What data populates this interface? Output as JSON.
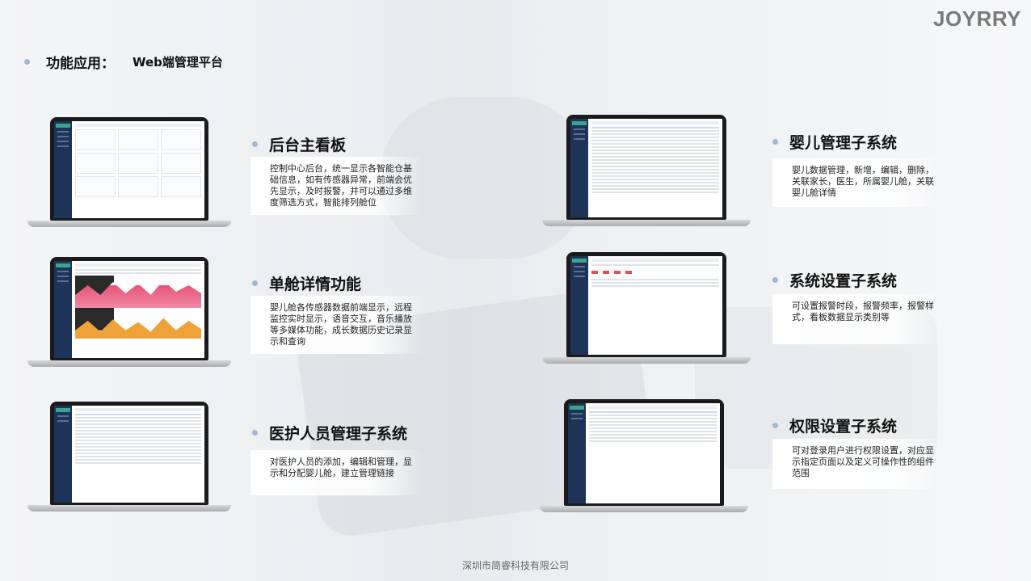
{
  "brand": "JOYRRY",
  "heading": {
    "label": "功能应用：",
    "sub": "Web端管理平台"
  },
  "sections": [
    {
      "title": "后台主看板",
      "desc": "控制中心后台，统一显示各智能仓基础信息，如有传感器异常，前端会优先显示，及时报警，并可以通过多维度筛选方式，智能排列舱位"
    },
    {
      "title": "单舱详情功能",
      "desc": "婴儿舱各传感器数据前端显示，远程监控实时显示，语音交互，音乐播放等多媒体功能，成长数据历史记录显示和查询"
    },
    {
      "title": "医护人员管理子系统",
      "desc": "对医护人员的添加，编辑和管理，显示和分配婴儿舱，建立管理链接"
    },
    {
      "title": "婴儿管理子系统",
      "desc": "婴儿数据管理，新增，编辑，删除，关联家长，医生，所属婴儿舱，关联婴儿舱详情"
    },
    {
      "title": "系统设置子系统",
      "desc": "可设置报警时段，报警频率，报警样式，看板数据显示类别等"
    },
    {
      "title": "权限设置子系统",
      "desc": "可对登录用户进行权限设置，对应显示指定页面以及定义可操作性的组件范围"
    }
  ],
  "footer": "深圳市简睿科技有限公司",
  "colors": {
    "accent_dot": "#9fb8d6",
    "sidebar": "#1d3358",
    "chart_pink": "#e8537a",
    "chart_orange": "#f0a23a"
  }
}
